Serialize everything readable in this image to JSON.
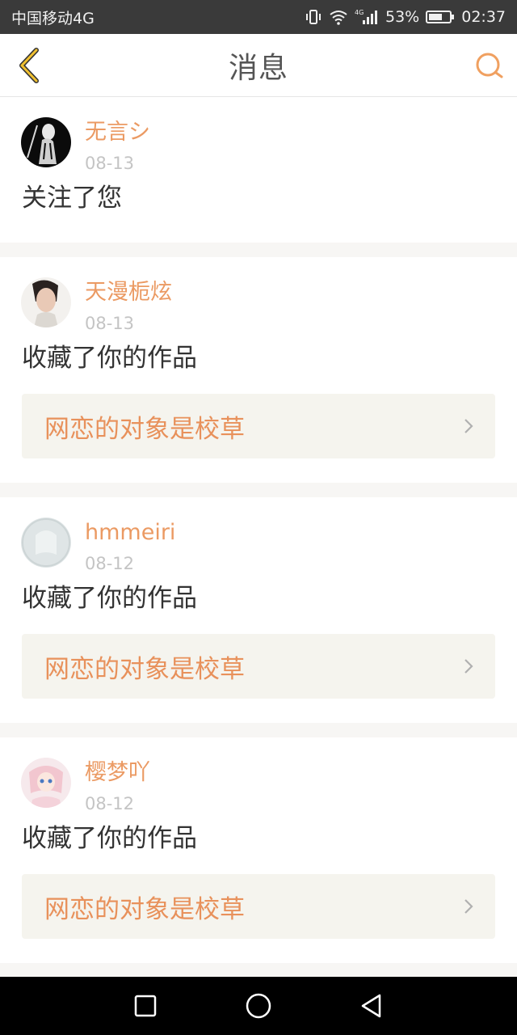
{
  "status_bar": {
    "carrier": "中国移动4G",
    "battery_percent": "53%",
    "time": "02:37",
    "net": "4G"
  },
  "header": {
    "title": "消息",
    "back_icon": "chevron-left-icon",
    "search_icon": "search-icon"
  },
  "colors": {
    "accent": "#eb9a63",
    "work_link_bg": "#f5f4ee"
  },
  "messages": [
    {
      "username": "无言シ",
      "date": "08-13",
      "action": "关注了您"
    },
    {
      "username": "天漫栀炫",
      "date": "08-13",
      "action": "收藏了你的作品",
      "work_title": "网恋的对象是校草"
    },
    {
      "username": "hmmeiri",
      "date": "08-12",
      "action": "收藏了你的作品",
      "work_title": "网恋的对象是校草"
    },
    {
      "username": "樱梦吖",
      "date": "08-12",
      "action": "收藏了你的作品",
      "work_title": "网恋的对象是校草"
    }
  ],
  "nav_bar": {
    "items": [
      "square-icon",
      "circle-icon",
      "triangle-back-icon"
    ]
  }
}
